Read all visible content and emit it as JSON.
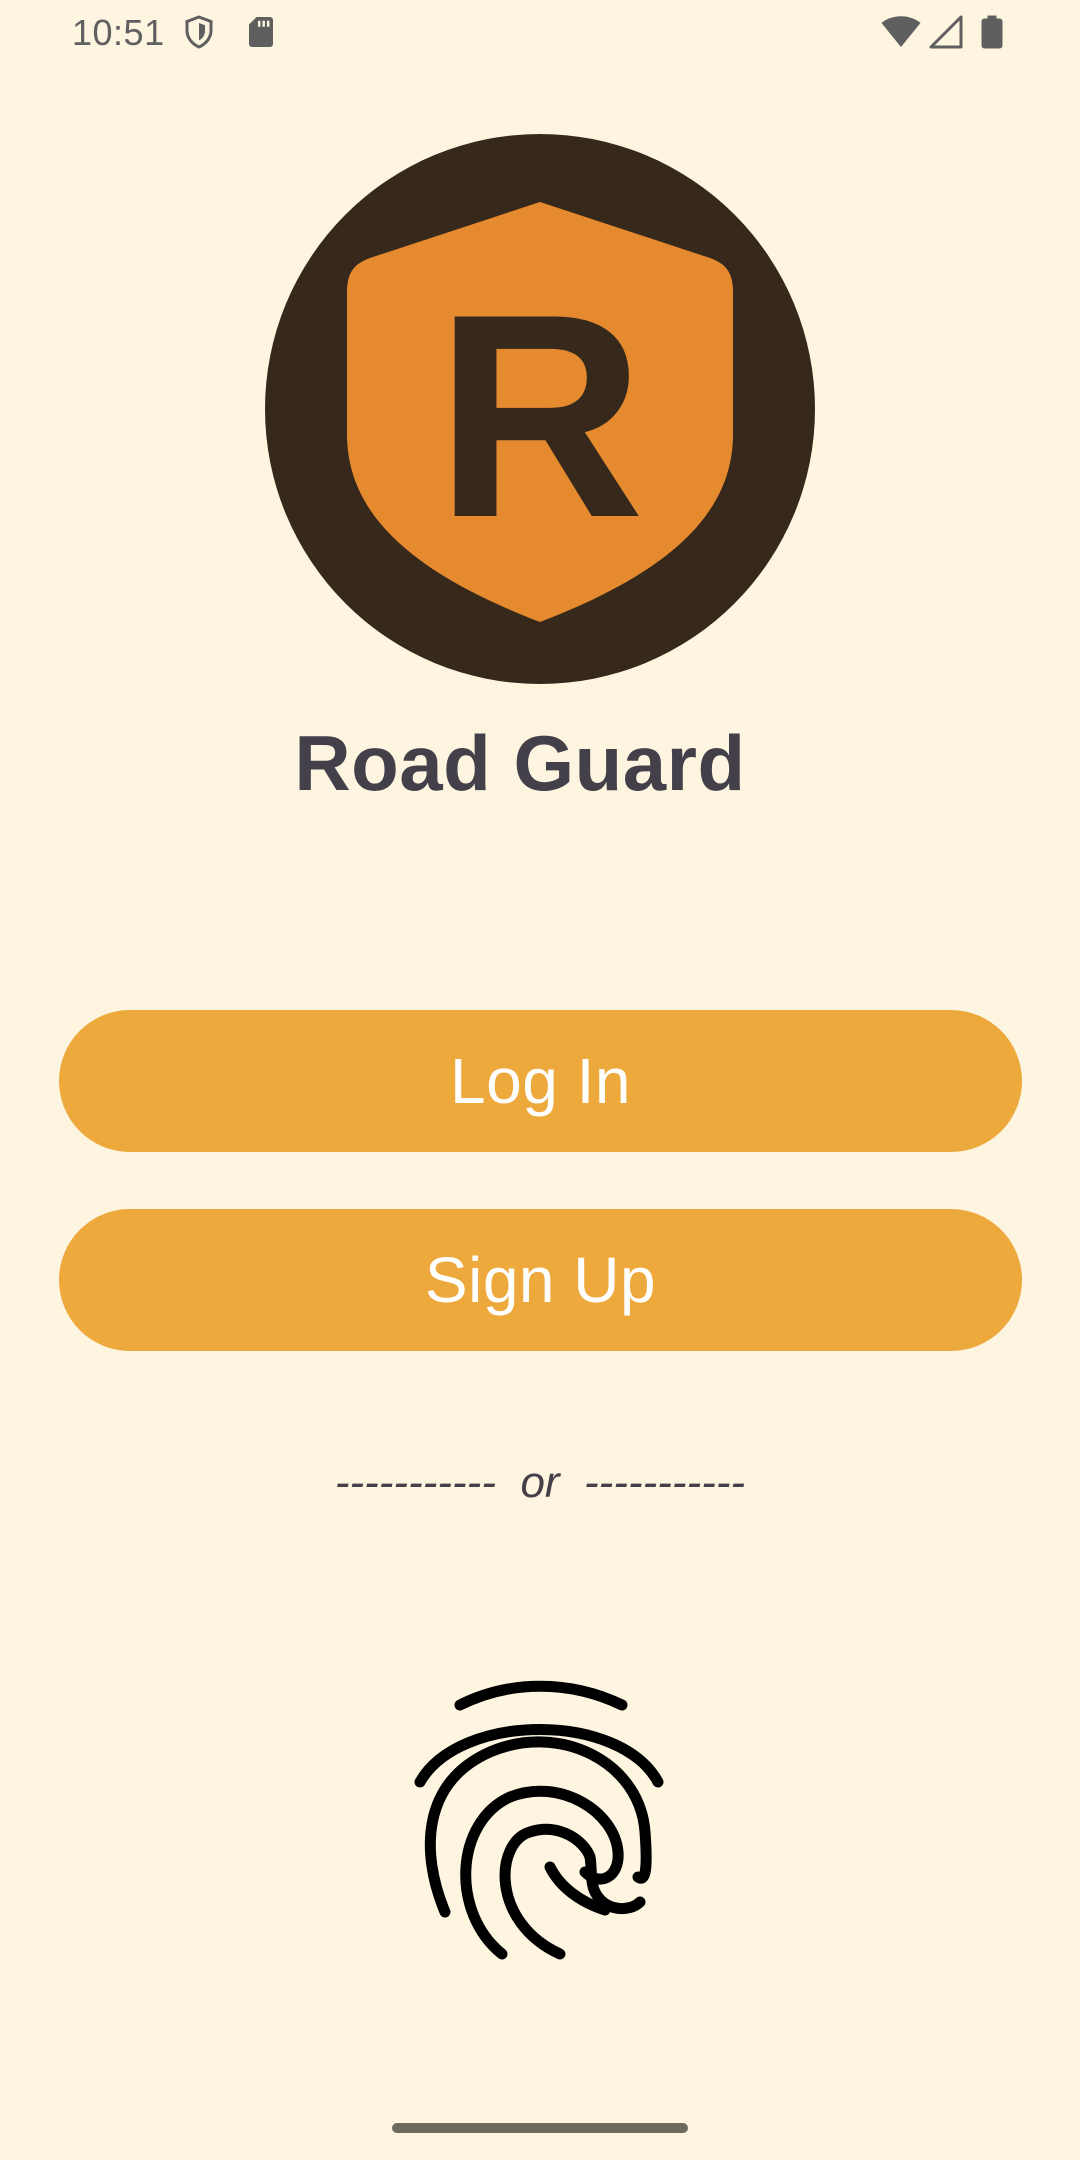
{
  "status_bar": {
    "time": "10:51",
    "icons": [
      "shield-icon",
      "sd-card-icon",
      "wifi-icon",
      "cell-signal-icon",
      "battery-icon"
    ]
  },
  "logo": {
    "letter": "R",
    "colors": {
      "circle": "#36291C",
      "shield": "#E68A30"
    }
  },
  "app": {
    "title": "Road Guard"
  },
  "buttons": {
    "login_label": "Log In",
    "signup_label": "Sign Up"
  },
  "divider": {
    "text": "-----------  or  -----------"
  },
  "fingerprint": {
    "icon": "fingerprint-icon"
  },
  "colors": {
    "background": "#FDF5E0",
    "button": "#EEA93D",
    "title": "#44404A"
  }
}
